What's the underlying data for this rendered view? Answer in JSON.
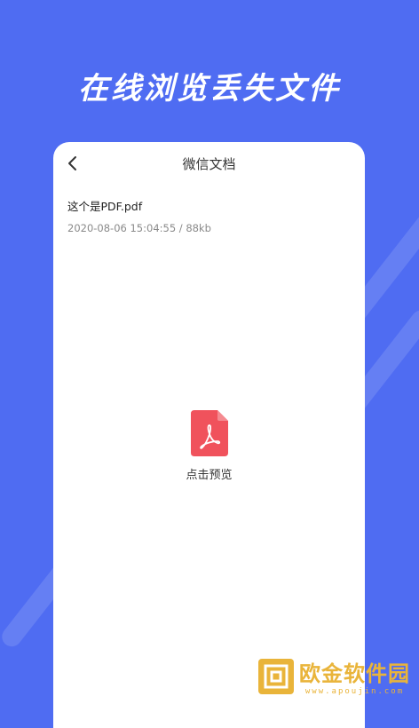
{
  "banner": {
    "headline": "在线浏览丢失文件"
  },
  "navbar": {
    "title": "微信文档",
    "back_icon": "chevron-left-icon"
  },
  "file": {
    "name": "这个是PDF.pdf",
    "meta": "2020-08-06 15:04:55 / 88kb"
  },
  "preview": {
    "label": "点击预览",
    "icon": "pdf-file-icon",
    "icon_color": "#f0525c"
  },
  "watermark": {
    "name": "欧金软件园",
    "url": "www.apoujin.com"
  },
  "colors": {
    "background": "#4f6cf2",
    "card": "#ffffff",
    "watermark": "#e9b43a"
  }
}
